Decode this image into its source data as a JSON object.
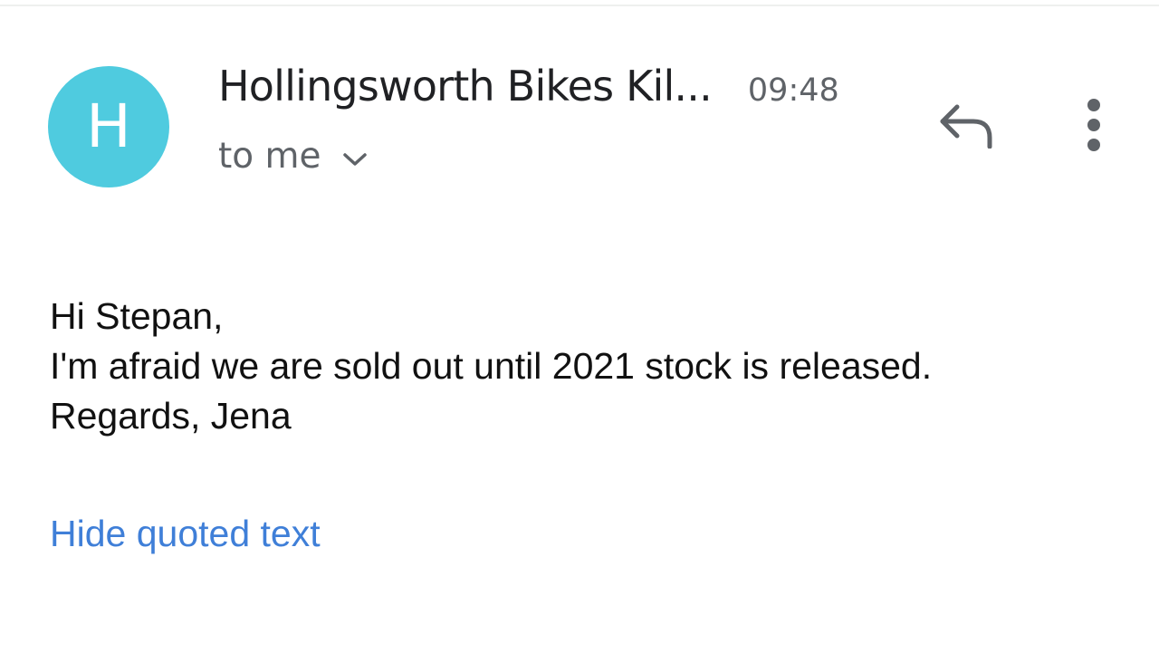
{
  "colors": {
    "avatar_bg": "#4fcbdf",
    "link": "#3f7fd8",
    "icon": "#5f6368"
  },
  "header": {
    "avatar_letter": "H",
    "sender": "Hollingsworth Bikes Kil...",
    "time": "09:48",
    "recipient": "to me",
    "icons": {
      "expand": "chevron-down-icon",
      "reply": "reply-icon",
      "more": "more-vert-icon"
    }
  },
  "message": {
    "lines": [
      "Hi Stepan,",
      "I'm afraid we are sold out until 2021 stock is released.",
      "Regards, Jena"
    ]
  },
  "quoted": {
    "toggle_label": "Hide quoted text"
  }
}
